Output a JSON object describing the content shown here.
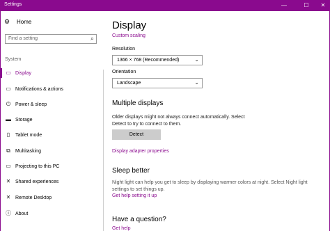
{
  "window": {
    "title": "Settings",
    "controls": {
      "minimize": "—",
      "maximize": "☐",
      "close": "✕"
    }
  },
  "sidebar": {
    "home": "Home",
    "search_placeholder": "Find a setting",
    "section": "System",
    "items": [
      {
        "label": "Display",
        "icon": "monitor-icon"
      },
      {
        "label": "Notifications & actions",
        "icon": "notifications-icon"
      },
      {
        "label": "Power & sleep",
        "icon": "power-icon"
      },
      {
        "label": "Storage",
        "icon": "storage-icon"
      },
      {
        "label": "Tablet mode",
        "icon": "tablet-icon"
      },
      {
        "label": "Multitasking",
        "icon": "multitasking-icon"
      },
      {
        "label": "Projecting to this PC",
        "icon": "projecting-icon"
      },
      {
        "label": "Shared experiences",
        "icon": "shared-experiences-icon"
      },
      {
        "label": "Remote Desktop",
        "icon": "remote-desktop-icon"
      },
      {
        "label": "About",
        "icon": "about-icon"
      }
    ]
  },
  "main": {
    "title": "Display",
    "custom_scaling": "Custom scaling",
    "resolution_label": "Resolution",
    "resolution_value": "1366 × 768 (Recommended)",
    "orientation_label": "Orientation",
    "orientation_value": "Landscape",
    "multiple_displays_heading": "Multiple displays",
    "multiple_displays_text_1": "Older displays might not always connect automatically. Select",
    "multiple_displays_text_2": "Detect to try to connect to them.",
    "detect_button": "Detect",
    "adapter_link": "Display adapter properties",
    "sleep_heading": "Sleep better",
    "sleep_text_1": "Night light can help you get to sleep by displaying warmer colors at night. Select Night light",
    "sleep_text_2": "settings to set things up.",
    "sleep_link": "Get help setting it up",
    "question_heading": "Have a question?",
    "question_link": "Get help"
  },
  "colors": {
    "accent": "#8a0a8e"
  }
}
